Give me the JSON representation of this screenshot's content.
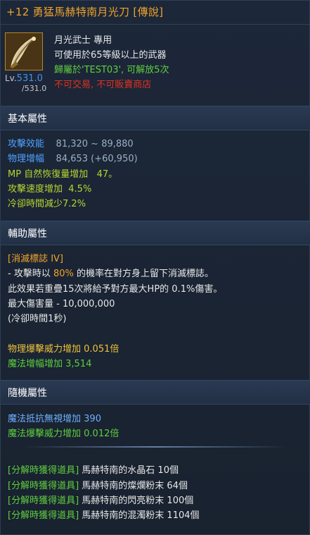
{
  "header": {
    "title": "+12 勇猛馬赫特南月光刀 [傳說]"
  },
  "item": {
    "icon": "moonlight-blade-icon",
    "level_prefix": "Lv.",
    "level": "531.0",
    "level_max": "/531.0",
    "class_line": "月光武士  專用",
    "level_req": "可使用於65等級以上的武器",
    "owner": "歸屬於'TEST03', 可解放5次",
    "restriction": "不可交易, 不可販賣商店"
  },
  "basic": {
    "header": "基本屬性",
    "attack_label": "攻擊效能",
    "attack_value": "81,320 ~ 89,880",
    "phys_label": "物理增幅",
    "phys_value": "84,653 (+60,950)",
    "mp_label": "MP 自然恢復量增加",
    "mp_value": "47。",
    "speed_label": "攻擊速度增加",
    "speed_value": "4.5%",
    "cooldown_label": "冷卻時間減少",
    "cooldown_value": "7.2%"
  },
  "aux": {
    "header": "輔助屬性",
    "skill_name": "[消滅標誌 IV]",
    "desc1_a": "- 攻擊時以",
    "desc1_pct": "80%",
    "desc1_b": "的機率在對方身上留下消滅標誌。",
    "desc2": "此效果若重疊15次將給予對方最大HP的 0.1%傷害。",
    "desc3": "最大傷害量 - 10,000,000",
    "desc4": "(冷卻時間1秒)",
    "crit_label": "物理爆擊威力增加",
    "crit_value": "0.051倍",
    "magic_label": "魔法增幅增加",
    "magic_value": "3,514"
  },
  "random": {
    "header": "隨機屬性",
    "resist_label": "魔法抵抗無視增加",
    "resist_value": "390",
    "mcrit_label": "魔法爆擊威力增加",
    "mcrit_value": "0.012倍"
  },
  "decompose": {
    "tag": "[分解時獲得道具]",
    "items": [
      "馬赫特南的水晶石 10個",
      "馬赫特南的燦爛粉末 64個",
      "馬赫特南的閃亮粉末 100個",
      "馬赫特南的混濁粉末 1104個"
    ]
  },
  "colors": {
    "title": "#f0a32c",
    "restriction": "#e0311f",
    "owner": "#5fcf3f",
    "stat_blue": "#4fa3ff",
    "stat_green": "#b7d630"
  }
}
